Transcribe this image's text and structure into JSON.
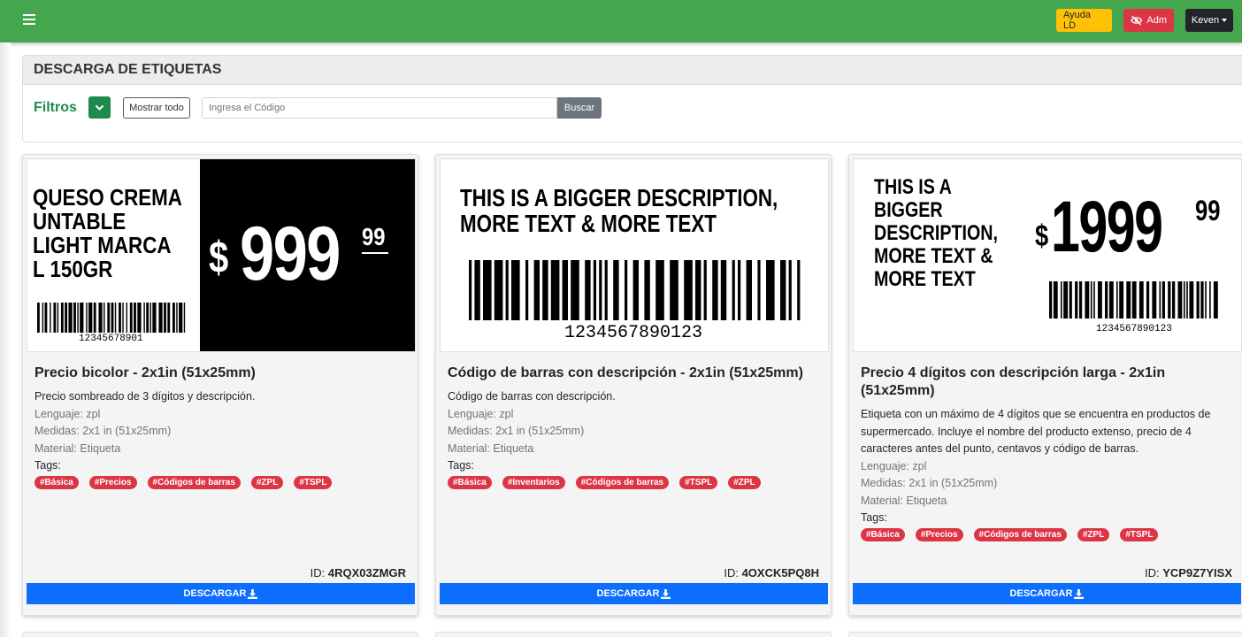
{
  "topbar": {
    "ayuda_label": "Ayuda LD",
    "adm_label": "Adm",
    "user_label": "Keven"
  },
  "filters": {
    "panel_title": "DESCARGA DE ETIQUETAS",
    "filtros_label": "Filtros",
    "show_all_label": "Mostrar todo",
    "search_placeholder": "Ingresa el Código",
    "search_value": "",
    "search_button": "Buscar"
  },
  "labels": {
    "language_prefix": "Lenguaje: ",
    "size_prefix": "Medidas: ",
    "material_prefix": "Material: ",
    "tags_label": "Tags:",
    "id_prefix": "ID: ",
    "download_label": "DESCARGAR"
  },
  "cards": [
    {
      "title": "Precio bicolor - 2x1in (51x25mm)",
      "description": "Precio sombreado de 3 dígitos y descripción.",
      "language": "zpl",
      "size": "2x1 in (51x25mm)",
      "material": "Etiqueta",
      "tags": [
        "#Básica",
        "#Precios",
        "#Códigos de barras",
        "#ZPL",
        "#TSPL"
      ],
      "id": "4RQX03ZMGR",
      "preview": {
        "line1": "QUESO CREMA",
        "line2": "UNTABLE",
        "line3": "LIGHT MARCA",
        "line4": "L 150GR",
        "barcode_number": "12345678901",
        "currency": "$",
        "price": "999",
        "cents": "99"
      }
    },
    {
      "title": "Código de barras con descripción - 2x1in (51x25mm)",
      "description": "Código de barras con descripción.",
      "language": "zpl",
      "size": "2x1 in (51x25mm)",
      "material": "Etiqueta",
      "tags": [
        "#Básica",
        "#Inventarios",
        "#Códigos de barras",
        "#TSPL",
        "#ZPL"
      ],
      "id": "4OXCK5PQ8H",
      "preview": {
        "line1": "THIS IS A BIGGER DESCRIPTION,",
        "line2": "MORE TEXT & MORE TEXT",
        "barcode_number": "1234567890123"
      }
    },
    {
      "title": "Precio 4 dígitos con descripción larga - 2x1in (51x25mm)",
      "description": "Etiqueta con un máximo de 4 dígitos que se encuentra en productos de supermercado. Incluye el nombre del producto extenso, precio de 4 caracteres antes del punto, centavos y código de barras.",
      "language": "zpl",
      "size": "2x1 in (51x25mm)",
      "material": "Etiqueta",
      "tags": [
        "#Básica",
        "#Precios",
        "#Códigos de barras",
        "#ZPL",
        "#TSPL"
      ],
      "id": "YCP9Z7YISX",
      "preview": {
        "line1": "THIS IS A",
        "line2": "BIGGER",
        "line3": "DESCRIPTION,",
        "line4": "MORE TEXT &",
        "line5": "MORE TEXT",
        "currency": "$",
        "price": "1999",
        "cents": "99",
        "barcode_number": "1234567890123"
      }
    }
  ]
}
